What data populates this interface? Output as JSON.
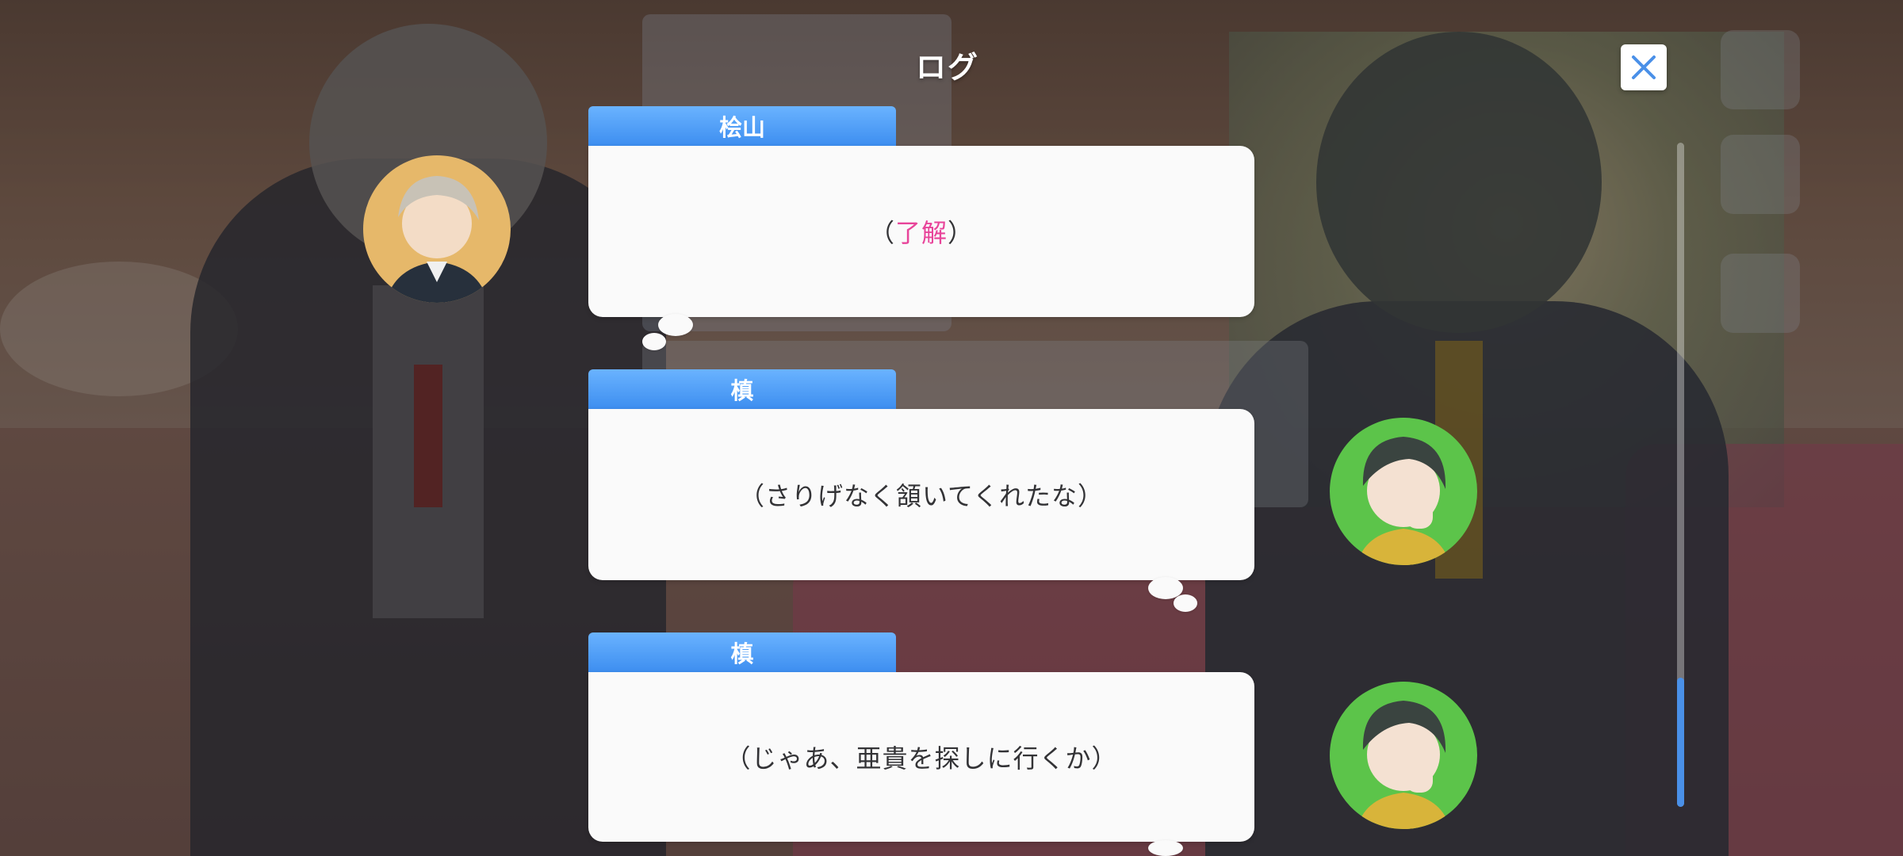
{
  "screen": {
    "title": "ログ",
    "close_icon": "close-icon"
  },
  "log": [
    {
      "speaker": "桧山",
      "text_pre": "（",
      "text_highlight": "了解",
      "text_post": "）",
      "avatar_bg": "#e6b86a",
      "avatar_side": "left"
    },
    {
      "speaker": "槙",
      "text": "（さりげなく頷いてくれたな）",
      "avatar_bg": "#5cc44a",
      "avatar_side": "right"
    },
    {
      "speaker": "槙",
      "text": "（じゃあ、亜貴を探しに行くか）",
      "avatar_bg": "#5cc44a",
      "avatar_side": "right"
    }
  ],
  "colors": {
    "tab_blue": "#3d8ef0",
    "highlight_pink": "#e8449a",
    "scroll_thumb": "#4a90e8"
  }
}
